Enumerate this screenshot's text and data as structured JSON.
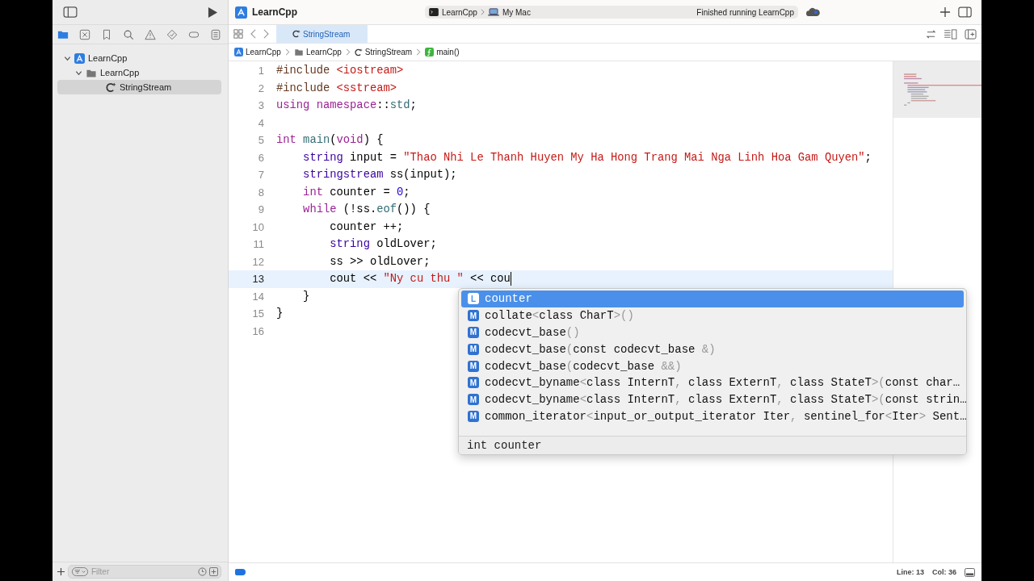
{
  "toolbar": {
    "project_title": "LearnCpp",
    "scheme": "LearnCpp",
    "destination": "My Mac",
    "status": "Finished running LearnCpp"
  },
  "navigator": {
    "tree": [
      {
        "label": "LearnCpp",
        "kind": "project",
        "expanded": true,
        "selected": false,
        "children": [
          {
            "label": "LearnCpp",
            "kind": "folder",
            "expanded": true,
            "selected": false,
            "children": [
              {
                "label": "StringStream",
                "kind": "file",
                "selected": true
              }
            ]
          }
        ]
      }
    ],
    "filter": {
      "placeholder": "Filter"
    }
  },
  "editor": {
    "tabs": [
      {
        "label": "StringStream",
        "selected": true
      }
    ],
    "breadcrumb": [
      {
        "label": "LearnCpp",
        "kind": "project"
      },
      {
        "label": "LearnCpp",
        "kind": "folder"
      },
      {
        "label": "StringStream",
        "kind": "file"
      },
      {
        "label": "main()",
        "kind": "function"
      }
    ],
    "lines": [
      {
        "number": "1",
        "current": false,
        "tokens": [
          {
            "kind": "preproc",
            "text": "#include "
          },
          {
            "kind": "string",
            "text": "<iostream>"
          }
        ]
      },
      {
        "number": "2",
        "current": false,
        "tokens": [
          {
            "kind": "preproc",
            "text": "#include "
          },
          {
            "kind": "string",
            "text": "<sstream>"
          }
        ]
      },
      {
        "number": "3",
        "current": false,
        "tokens": [
          {
            "kind": "keyword",
            "text": "using namespace"
          },
          {
            "kind": "plain",
            "text": "::"
          },
          {
            "kind": "func",
            "text": "std"
          },
          {
            "kind": "plain",
            "text": ";"
          }
        ]
      },
      {
        "number": "4",
        "current": false
      },
      {
        "number": "5",
        "current": false,
        "tokens": [
          {
            "kind": "keyword",
            "text": "int"
          },
          {
            "kind": "func",
            "text": " main"
          },
          {
            "kind": "plain",
            "text": "("
          },
          {
            "kind": "keyword",
            "text": "void"
          },
          {
            "kind": "plain",
            "text": ") {"
          }
        ]
      },
      {
        "number": "6",
        "current": false,
        "tokens": [
          {
            "kind": "type",
            "text": "    string"
          },
          {
            "kind": "plain",
            "text": " input = "
          },
          {
            "kind": "string",
            "text": "\"Thao Nhi Le Thanh Huyen My Ha Hong Trang Mai Nga Linh Hoa Gam Quyen\""
          },
          {
            "kind": "plain",
            "text": ";"
          }
        ]
      },
      {
        "number": "7",
        "current": false,
        "tokens": [
          {
            "kind": "type",
            "text": "    stringstream"
          },
          {
            "kind": "plain",
            "text": " ss(input);"
          }
        ]
      },
      {
        "number": "8",
        "current": false,
        "tokens": [
          {
            "kind": "keyword",
            "text": "    int"
          },
          {
            "kind": "plain",
            "text": " counter = "
          },
          {
            "kind": "number",
            "text": "0"
          },
          {
            "kind": "plain",
            "text": ";"
          }
        ]
      },
      {
        "number": "9",
        "current": false,
        "tokens": [
          {
            "kind": "keyword",
            "text": "    while"
          },
          {
            "kind": "plain",
            "text": " (!ss."
          },
          {
            "kind": "func",
            "text": "eof"
          },
          {
            "kind": "plain",
            "text": "()) {"
          }
        ]
      },
      {
        "number": "10",
        "current": false,
        "tokens": [
          {
            "kind": "plain",
            "text": "        counter ++;"
          }
        ]
      },
      {
        "number": "11",
        "current": false,
        "tokens": [
          {
            "kind": "type",
            "text": "        string"
          },
          {
            "kind": "plain",
            "text": " oldLover;"
          }
        ]
      },
      {
        "number": "12",
        "current": false,
        "tokens": [
          {
            "kind": "plain",
            "text": "        ss >> oldLover;"
          }
        ]
      },
      {
        "number": "13",
        "current": true,
        "tokens": [
          {
            "kind": "plain",
            "text": "        cout << "
          },
          {
            "kind": "string",
            "text": "\"Ny cu thu \""
          },
          {
            "kind": "plain",
            "text": " << cou"
          }
        ]
      },
      {
        "number": "14",
        "current": false,
        "tokens": [
          {
            "kind": "plain",
            "text": "    }"
          }
        ]
      },
      {
        "number": "15",
        "current": false,
        "tokens": [
          {
            "kind": "plain",
            "text": "}"
          }
        ]
      },
      {
        "number": "16",
        "current": false
      }
    ],
    "completion": {
      "items": [
        {
          "badge": "L",
          "selected": true,
          "parts": [
            {
              "text": "counter",
              "dim": false
            }
          ]
        },
        {
          "badge": "M",
          "selected": false,
          "parts": [
            {
              "text": "collate",
              "dim": false
            },
            {
              "text": "<",
              "dim": true
            },
            {
              "text": "class CharT",
              "dim": false
            },
            {
              "text": ">()",
              "dim": true
            }
          ]
        },
        {
          "badge": "M",
          "selected": false,
          "parts": [
            {
              "text": "codecvt_base",
              "dim": false
            },
            {
              "text": "()",
              "dim": true
            }
          ]
        },
        {
          "badge": "M",
          "selected": false,
          "parts": [
            {
              "text": "codecvt_base",
              "dim": false
            },
            {
              "text": "(",
              "dim": true
            },
            {
              "text": "const codecvt_base",
              "dim": false
            },
            {
              "text": " &)",
              "dim": true
            }
          ]
        },
        {
          "badge": "M",
          "selected": false,
          "parts": [
            {
              "text": "codecvt_base",
              "dim": false
            },
            {
              "text": "(",
              "dim": true
            },
            {
              "text": "codecvt_base",
              "dim": false
            },
            {
              "text": " &&)",
              "dim": true
            }
          ]
        },
        {
          "badge": "M",
          "selected": false,
          "parts": [
            {
              "text": "codecvt_byname",
              "dim": false
            },
            {
              "text": "<",
              "dim": true
            },
            {
              "text": "class InternT",
              "dim": false
            },
            {
              "text": ", ",
              "dim": true
            },
            {
              "text": "class ExternT",
              "dim": false
            },
            {
              "text": ", ",
              "dim": true
            },
            {
              "text": "class StateT",
              "dim": false
            },
            {
              "text": ">(",
              "dim": true
            },
            {
              "text": "const char…",
              "dim": false
            }
          ]
        },
        {
          "badge": "M",
          "selected": false,
          "parts": [
            {
              "text": "codecvt_byname",
              "dim": false
            },
            {
              "text": "<",
              "dim": true
            },
            {
              "text": "class InternT",
              "dim": false
            },
            {
              "text": ", ",
              "dim": true
            },
            {
              "text": "class ExternT",
              "dim": false
            },
            {
              "text": ", ",
              "dim": true
            },
            {
              "text": "class StateT",
              "dim": false
            },
            {
              "text": ">(",
              "dim": true
            },
            {
              "text": "const strin…",
              "dim": false
            }
          ]
        },
        {
          "badge": "M",
          "selected": false,
          "parts": [
            {
              "text": "common_iterator",
              "dim": false
            },
            {
              "text": "<",
              "dim": true
            },
            {
              "text": "input_or_output_iterator Iter",
              "dim": false
            },
            {
              "text": ", ",
              "dim": true
            },
            {
              "text": "sentinel_for",
              "dim": false
            },
            {
              "text": "<",
              "dim": true
            },
            {
              "text": "Iter",
              "dim": false
            },
            {
              "text": ">",
              "dim": true
            },
            {
              "text": " Sent…",
              "dim": false
            }
          ]
        }
      ],
      "detail": "int counter"
    }
  },
  "status_bar": {
    "line": "Line: 13",
    "column": "Col: 36"
  }
}
